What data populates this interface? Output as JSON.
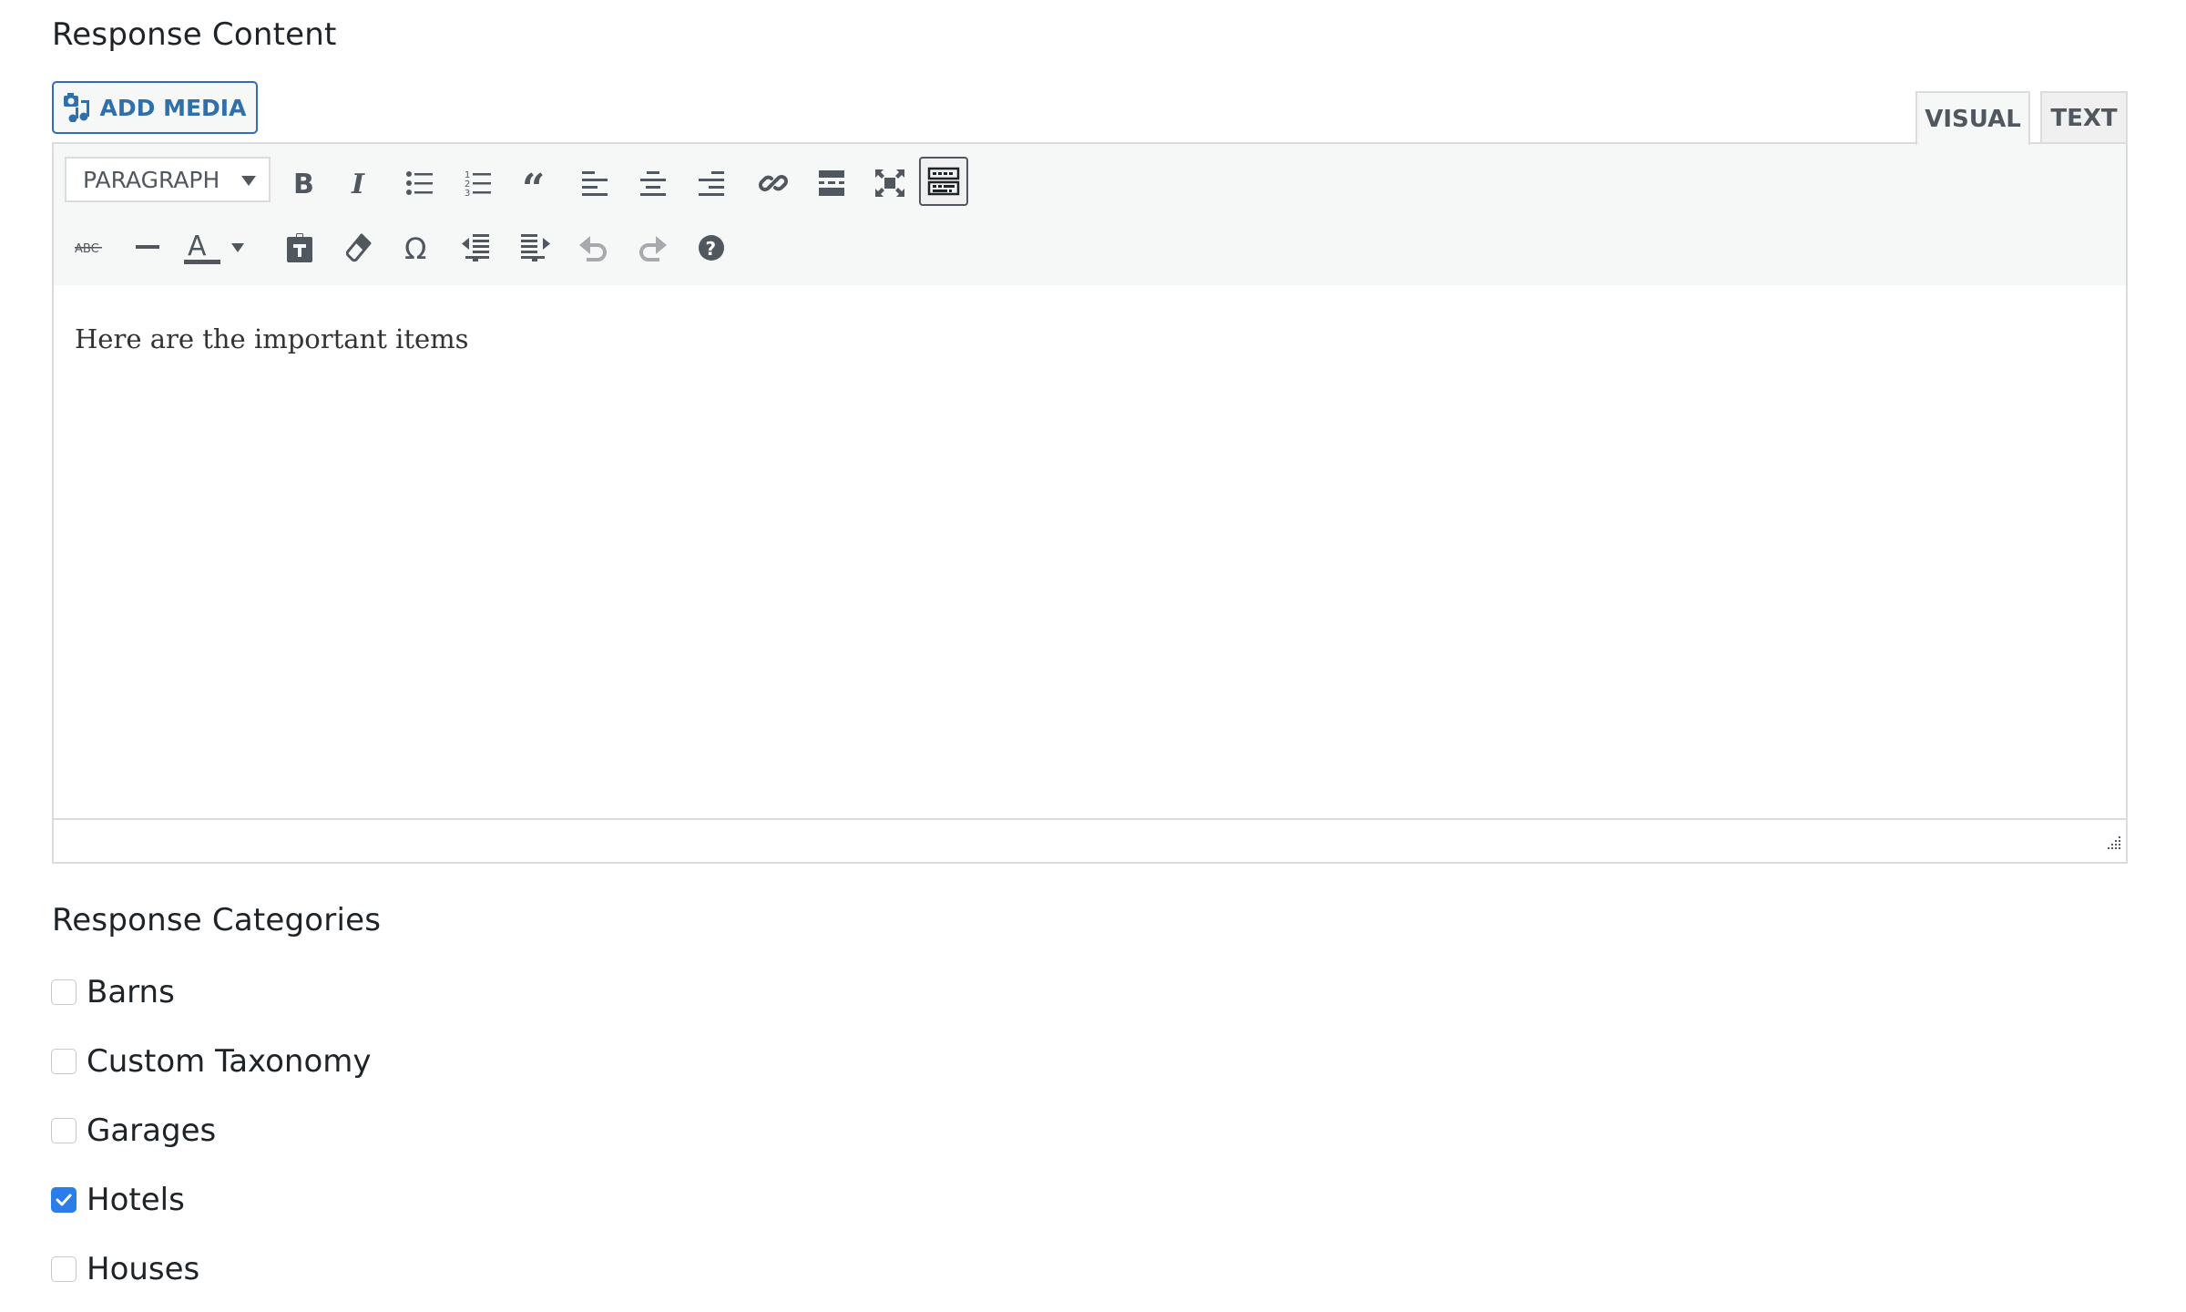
{
  "sections": {
    "content_title": "Response Content",
    "categories_title": "Response Categories"
  },
  "toolbar_top": {
    "add_media_label": "ADD MEDIA",
    "tabs": [
      {
        "label": "VISUAL",
        "active": true
      },
      {
        "label": "TEXT",
        "active": false
      }
    ]
  },
  "editor": {
    "format_select": "PARAGRAPH",
    "row1_buttons": [
      "bold-icon",
      "italic-icon",
      "bullet-list-icon",
      "numbered-list-icon",
      "blockquote-icon",
      "align-left-icon",
      "align-center-icon",
      "align-right-icon",
      "link-icon",
      "read-more-icon",
      "fullscreen-icon",
      "toolbar-toggle-icon"
    ],
    "row2_buttons": [
      "strikethrough-icon",
      "horizontal-line-icon",
      "text-color-icon",
      "paste-text-icon",
      "clear-formatting-icon",
      "special-character-icon",
      "outdent-icon",
      "indent-icon",
      "undo-icon",
      "redo-icon",
      "help-icon"
    ],
    "content": "Here are the important items"
  },
  "categories": [
    {
      "label": "Barns",
      "checked": false
    },
    {
      "label": "Custom Taxonomy",
      "checked": false
    },
    {
      "label": "Garages",
      "checked": false
    },
    {
      "label": "Hotels",
      "checked": true
    },
    {
      "label": "Houses",
      "checked": false
    }
  ],
  "colors": {
    "accent": "#2f6fab",
    "checkbox_checked": "#2b7de9",
    "icon": "#50575e",
    "icon_disabled": "#a7aaad"
  }
}
